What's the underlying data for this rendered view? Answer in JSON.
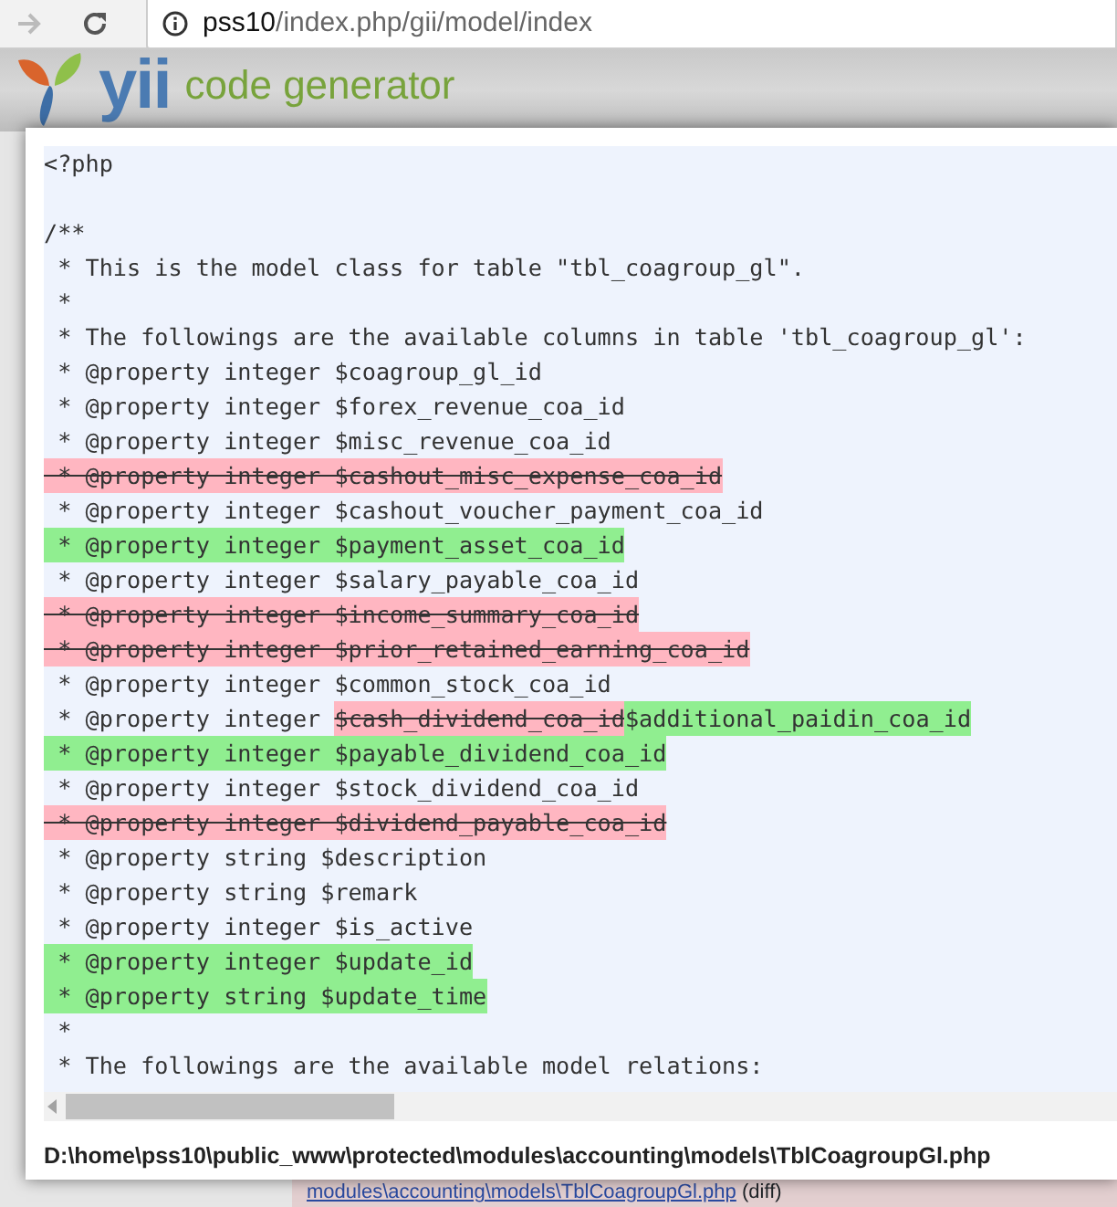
{
  "browser": {
    "address_host": "pss10",
    "address_path": "/index.php/gii/model/index"
  },
  "header": {
    "logo_text": "yii",
    "subtitle": "code generator"
  },
  "code_preview": {
    "lines": [
      {
        "kind": "text",
        "segments": [
          {
            "text": "<?php",
            "removed": false,
            "added": false
          }
        ]
      },
      {
        "kind": "blank"
      },
      {
        "kind": "text",
        "segments": [
          {
            "text": "/**",
            "removed": false,
            "added": false
          }
        ]
      },
      {
        "kind": "text",
        "segments": [
          {
            "text": " * This is the model class for table \"tbl_coagroup_gl\".",
            "removed": false,
            "added": false
          }
        ]
      },
      {
        "kind": "text",
        "segments": [
          {
            "text": " *",
            "removed": false,
            "added": false
          }
        ]
      },
      {
        "kind": "text",
        "segments": [
          {
            "text": " * The followings are the available columns in table 'tbl_coagroup_gl':",
            "removed": false,
            "added": false
          }
        ]
      },
      {
        "kind": "text",
        "segments": [
          {
            "text": " * @property integer $coagroup_gl_id",
            "removed": false,
            "added": false
          }
        ]
      },
      {
        "kind": "text",
        "segments": [
          {
            "text": " * @property integer $forex_revenue_coa_id",
            "removed": false,
            "added": false
          }
        ]
      },
      {
        "kind": "text",
        "segments": [
          {
            "text": " * @property integer $misc_revenue_coa_id",
            "removed": false,
            "added": false
          }
        ]
      },
      {
        "kind": "text",
        "segments": [
          {
            "text": " * @property integer $cashout_misc_expense_coa_id",
            "removed": true,
            "added": false
          }
        ]
      },
      {
        "kind": "text",
        "segments": [
          {
            "text": " * @property integer $cashout_voucher_payment_coa_id",
            "removed": false,
            "added": false
          }
        ]
      },
      {
        "kind": "text",
        "segments": [
          {
            "text": " * @property integer $payment_asset_coa_id",
            "removed": false,
            "added": true
          }
        ]
      },
      {
        "kind": "text",
        "segments": [
          {
            "text": " * @property integer $salary_payable_coa_id",
            "removed": false,
            "added": false
          }
        ]
      },
      {
        "kind": "text",
        "segments": [
          {
            "text": " * @property integer $income_summary_coa_id",
            "removed": true,
            "added": false
          }
        ]
      },
      {
        "kind": "text",
        "segments": [
          {
            "text": " * @property integer $prior_retained_earning_coa_id",
            "removed": true,
            "added": false
          }
        ]
      },
      {
        "kind": "text",
        "segments": [
          {
            "text": " * @property integer $common_stock_coa_id",
            "removed": false,
            "added": false
          }
        ]
      },
      {
        "kind": "text",
        "segments": [
          {
            "text": " * @property integer ",
            "removed": false,
            "added": false
          },
          {
            "text": "$cash_dividend_coa_id",
            "removed": true,
            "added": false
          },
          {
            "text": "$additional_paidin_coa_id",
            "removed": false,
            "added": true
          }
        ]
      },
      {
        "kind": "text",
        "segments": [
          {
            "text": " * @property integer $payable_dividend_coa_id",
            "removed": false,
            "added": true
          }
        ]
      },
      {
        "kind": "text",
        "segments": [
          {
            "text": " * @property integer $stock_dividend_coa_id",
            "removed": false,
            "added": false
          }
        ]
      },
      {
        "kind": "text",
        "segments": [
          {
            "text": " * @property integer $dividend_payable_coa_id",
            "removed": true,
            "added": false
          }
        ]
      },
      {
        "kind": "text",
        "segments": [
          {
            "text": " * @property string $description",
            "removed": false,
            "added": false
          }
        ]
      },
      {
        "kind": "text",
        "segments": [
          {
            "text": " * @property string $remark",
            "removed": false,
            "added": false
          }
        ]
      },
      {
        "kind": "text",
        "segments": [
          {
            "text": " * @property integer $is_active",
            "removed": false,
            "added": false
          }
        ]
      },
      {
        "kind": "text",
        "segments": [
          {
            "text": " * @property integer $update_id",
            "removed": false,
            "added": true
          }
        ]
      },
      {
        "kind": "text",
        "segments": [
          {
            "text": " * @property string $update_time",
            "removed": false,
            "added": true
          }
        ]
      },
      {
        "kind": "text",
        "segments": [
          {
            "text": " *",
            "removed": false,
            "added": false
          }
        ]
      },
      {
        "kind": "text",
        "segments": [
          {
            "text": " * The followings are the available model relations:",
            "removed": false,
            "added": false
          }
        ]
      }
    ],
    "file_path": "D:\\home\\pss10\\public_www\\protected\\modules\\accounting\\models\\TblCoagroupGl.php"
  },
  "background_page": {
    "file_link": "modules\\accounting\\models\\TblCoagroupGl.php",
    "diff_link": "(diff)"
  }
}
